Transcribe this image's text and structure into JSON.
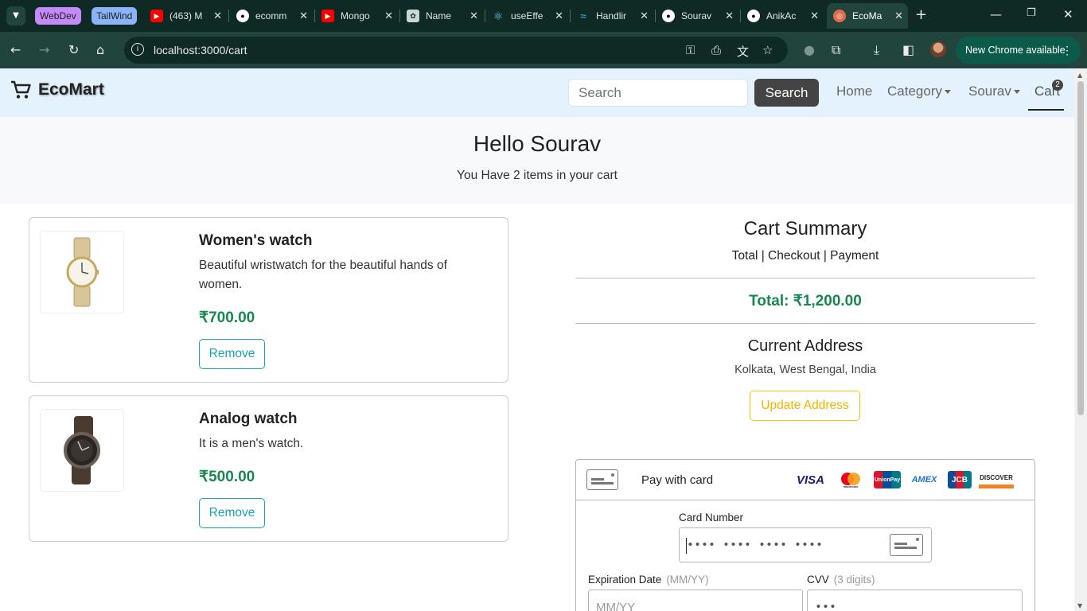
{
  "browser": {
    "tab_groups": [
      {
        "label": "WebDev",
        "color": "#c58af9"
      },
      {
        "label": "TailWind",
        "color": "#8ab4f8"
      }
    ],
    "tabs": [
      {
        "title": "(463) M",
        "favicon": "youtube-icon"
      },
      {
        "title": "ecomm",
        "favicon": "github-icon"
      },
      {
        "title": "Mongo",
        "favicon": "youtube-icon"
      },
      {
        "title": "Name",
        "favicon": "chatgpt-icon"
      },
      {
        "title": "useEffe",
        "favicon": "react-icon"
      },
      {
        "title": "Handlir",
        "favicon": "tailwind-icon"
      },
      {
        "title": "Sourav",
        "favicon": "github-icon"
      },
      {
        "title": "AnikAc",
        "favicon": "github-icon"
      },
      {
        "title": "EcoMa",
        "favicon": "ecomart-icon",
        "active": true
      }
    ],
    "url": "localhost:3000/cart",
    "update_label": "New Chrome available"
  },
  "navbar": {
    "brand": "EcoMart",
    "search_placeholder": "Search",
    "search_button": "Search",
    "links": {
      "home": "Home",
      "category": "Category",
      "user": "Sourav",
      "cart": "Cart"
    },
    "cart_count": "2"
  },
  "hero": {
    "greeting": "Hello Sourav",
    "message": "You Have 2 items in your cart"
  },
  "cart_items": [
    {
      "name": "Women's watch",
      "description": "Beautiful wristwatch for the beautiful hands of women.",
      "price": "₹700.00",
      "remove_label": "Remove"
    },
    {
      "name": "Analog watch",
      "description": "It is a men's watch.",
      "price": "₹500.00",
      "remove_label": "Remove"
    }
  ],
  "summary": {
    "title": "Cart Summary",
    "subtitle": "Total | Checkout | Payment",
    "total": "Total: ₹1,200.00",
    "address_heading": "Current Address",
    "address": "Kolkata, West Bengal, India",
    "update_address": "Update Address"
  },
  "payment": {
    "pay_with_card": "Pay with card",
    "card_brands": [
      "VISA",
      "mastercard",
      "UnionPay",
      "AMEX",
      "JCB",
      "DISCOVER"
    ],
    "card_number_label": "Card Number",
    "card_number_placeholder": "•••• •••• •••• ••••",
    "expiration_label": "Expiration Date",
    "expiration_hint": "(MM/YY)",
    "expiration_placeholder": "MM/YY",
    "cvv_label": "CVV",
    "cvv_hint": "(3 digits)",
    "cvv_placeholder": "•••"
  },
  "colors": {
    "accent_green": "#198754",
    "remove_teal": "#17a2b8",
    "update_yellow": "#ffc107",
    "navbar_bg": "#e3f2fd"
  }
}
